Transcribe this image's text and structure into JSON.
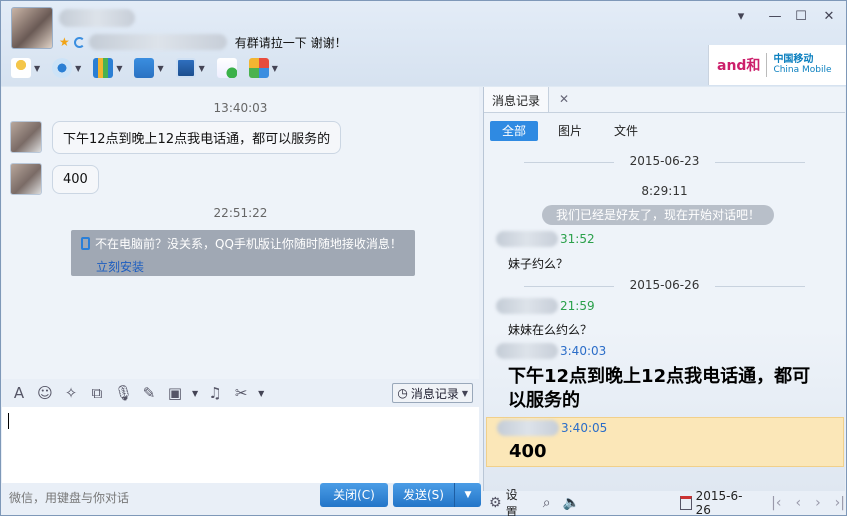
{
  "header": {
    "signature": "有群请拉一下 谢谢！"
  },
  "toolbar": {
    "items": [
      "mic-icon",
      "video-icon",
      "screen-share-icon",
      "file-transfer-icon",
      "remote-desktop-icon",
      "add-to-chat-icon",
      "apps-icon"
    ]
  },
  "ad": {
    "brand_cn": "中国移动",
    "brand_en": "China Mobile",
    "and_text": "and和"
  },
  "chat": {
    "ts1": "13:40:03",
    "msg1": "下午12点到晚上12点我电话通，都可以服务的",
    "msg2": "400",
    "ts2": "22:51:22",
    "notice_text": "不在电脑前？没关系，QQ手机版让你随时随地接收消息！",
    "notice_link": "立刻安装"
  },
  "input": {
    "history_button": "消息记录",
    "hint": "微信，用键盘与你对话",
    "close_label": "关闭(C)",
    "send_label": "发送(S)"
  },
  "history": {
    "tab_label": "消息记录",
    "filters": [
      "全部",
      "图片",
      "文件"
    ],
    "date1": "2015-06-23",
    "time1": "8:29:11",
    "system_msg": "我们已经是好友了，现在开始对话吧！",
    "entries": [
      {
        "time": "31:52",
        "text": "妹子约么？"
      },
      {
        "time": "21:59",
        "text": "妹妹在么约么？"
      }
    ],
    "date2": "2015-06-26",
    "big1_time": "3:40:03",
    "big1_text": "下午12点到晚上12点我电话通，都可以服务的",
    "big2_time": "3:40:05",
    "big2_text": "400",
    "footer_settings": "设置",
    "footer_date": "2015-6-26"
  }
}
